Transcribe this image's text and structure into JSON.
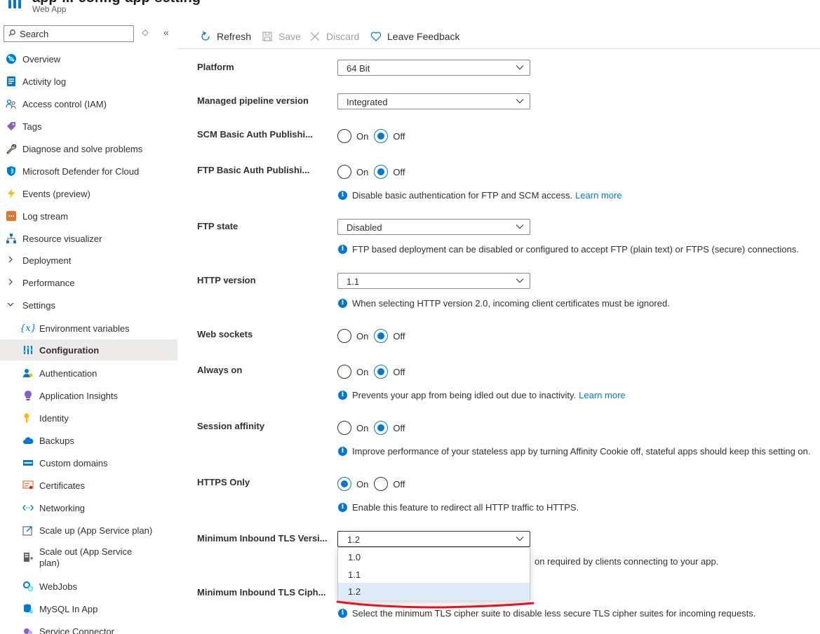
{
  "header": {
    "title": "app-...-config-app-setting",
    "subtitle": "Web App"
  },
  "sidebar": {
    "search_placeholder": "Search",
    "items": [
      {
        "label": "Overview",
        "icon": "globe-icon"
      },
      {
        "label": "Activity log",
        "icon": "log-icon"
      },
      {
        "label": "Access control (IAM)",
        "icon": "people-icon"
      },
      {
        "label": "Tags",
        "icon": "tag-icon"
      },
      {
        "label": "Diagnose and solve problems",
        "icon": "wrench-icon"
      },
      {
        "label": "Microsoft Defender for Cloud",
        "icon": "shield-icon"
      },
      {
        "label": "Events (preview)",
        "icon": "lightning-icon"
      },
      {
        "label": "Log stream",
        "icon": "stream-icon"
      },
      {
        "label": "Resource visualizer",
        "icon": "network-icon"
      },
      {
        "label": "Deployment",
        "icon": "chevron-right-icon"
      },
      {
        "label": "Performance",
        "icon": "chevron-right-icon"
      },
      {
        "label": "Settings",
        "icon": "chevron-down-icon"
      },
      {
        "label": "Environment variables",
        "icon": "variable-icon"
      },
      {
        "label": "Configuration",
        "icon": "configuration-icon"
      },
      {
        "label": "Authentication",
        "icon": "user-key-icon"
      },
      {
        "label": "Application Insights",
        "icon": "lightbulb-icon"
      },
      {
        "label": "Identity",
        "icon": "key-icon"
      },
      {
        "label": "Backups",
        "icon": "cloud-icon"
      },
      {
        "label": "Custom domains",
        "icon": "domain-icon"
      },
      {
        "label": "Certificates",
        "icon": "certificate-icon"
      },
      {
        "label": "Networking",
        "icon": "networking-icon"
      },
      {
        "label": "Scale up (App Service plan)",
        "icon": "scale-up-icon"
      },
      {
        "label": "Scale out (App Service plan)",
        "icon": "scale-out-icon"
      },
      {
        "label": "WebJobs",
        "icon": "gears-icon"
      },
      {
        "label": "MySQL In App",
        "icon": "database-icon"
      },
      {
        "label": "Service Connector",
        "icon": "connector-icon"
      }
    ]
  },
  "toolbar": {
    "refresh": "Refresh",
    "save": "Save",
    "discard": "Discard",
    "feedback": "Leave Feedback"
  },
  "settings": {
    "platform": {
      "label": "Platform",
      "value": "64 Bit"
    },
    "pipeline": {
      "label": "Managed pipeline version",
      "value": "Integrated"
    },
    "scm_auth": {
      "label": "SCM Basic Auth Publishi...",
      "on": "On",
      "off": "Off",
      "selected": "Off"
    },
    "ftp_auth": {
      "label": "FTP Basic Auth Publishi...",
      "on": "On",
      "off": "Off",
      "selected": "Off",
      "info": "Disable basic authentication for FTP and SCM access.",
      "link": "Learn more"
    },
    "ftp_state": {
      "label": "FTP state",
      "value": "Disabled",
      "info": "FTP based deployment can be disabled or configured to accept FTP (plain text) or FTPS (secure) connections."
    },
    "http_version": {
      "label": "HTTP version",
      "value": "1.1",
      "info": "When selecting HTTP version 2.0, incoming client certificates must be ignored."
    },
    "web_sockets": {
      "label": "Web sockets",
      "on": "On",
      "off": "Off",
      "selected": "Off"
    },
    "always_on": {
      "label": "Always on",
      "on": "On",
      "off": "Off",
      "selected": "Off",
      "info": "Prevents your app from being idled out due to inactivity.",
      "link": "Learn more"
    },
    "session_affinity": {
      "label": "Session affinity",
      "on": "On",
      "off": "Off",
      "selected": "Off",
      "info": "Improve performance of your stateless app by turning Affinity Cookie off, stateful apps should keep this setting on."
    },
    "https_only": {
      "label": "HTTPS Only",
      "on": "On",
      "off": "Off",
      "selected": "On",
      "info": "Enable this feature to redirect all HTTP traffic to HTTPS."
    },
    "min_tls": {
      "label": "Minimum Inbound TLS Versi...",
      "value": "1.2",
      "info_partial": "on required by clients connecting to your app.",
      "options": [
        "1.0",
        "1.1",
        "1.2"
      ],
      "selected": "1.2"
    },
    "min_tls_cipher": {
      "label": "Minimum Inbound TLS Ciph...",
      "info": "Select the minimum TLS cipher suite to disable less secure TLS cipher suites for incoming requests."
    }
  },
  "colors": {
    "accent": "#0078d4",
    "annotation": "#e81123",
    "selected_bg": "#edebe9",
    "option_selected_bg": "#deecf9"
  }
}
